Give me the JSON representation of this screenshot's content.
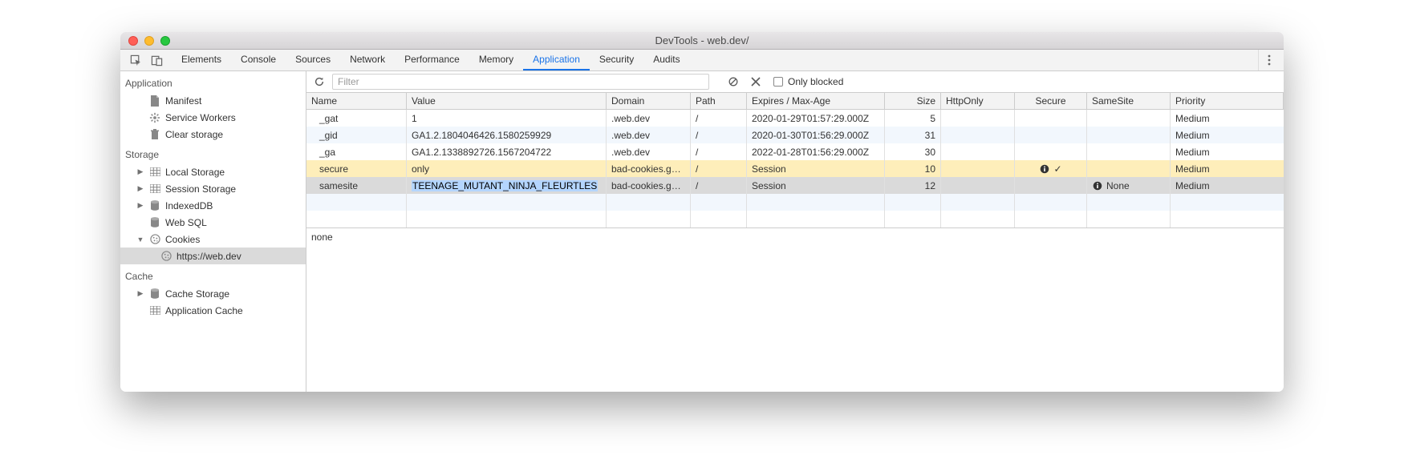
{
  "window": {
    "title": "DevTools - web.dev/"
  },
  "tabs": {
    "items": [
      "Elements",
      "Console",
      "Sources",
      "Network",
      "Performance",
      "Memory",
      "Application",
      "Security",
      "Audits"
    ],
    "active_index": 6
  },
  "sidebar": {
    "sections": {
      "application": {
        "label": "Application",
        "items": [
          {
            "label": "Manifest",
            "icon": "file"
          },
          {
            "label": "Service Workers",
            "icon": "gear"
          },
          {
            "label": "Clear storage",
            "icon": "trash"
          }
        ]
      },
      "storage": {
        "label": "Storage",
        "items": [
          {
            "label": "Local Storage",
            "icon": "grid",
            "expandable": true,
            "expanded": false
          },
          {
            "label": "Session Storage",
            "icon": "grid",
            "expandable": true,
            "expanded": false
          },
          {
            "label": "IndexedDB",
            "icon": "db",
            "expandable": true,
            "expanded": false
          },
          {
            "label": "Web SQL",
            "icon": "db",
            "expandable": false
          },
          {
            "label": "Cookies",
            "icon": "cookie",
            "expandable": true,
            "expanded": true,
            "children": [
              {
                "label": "https://web.dev",
                "icon": "cookie",
                "selected": true
              }
            ]
          }
        ]
      },
      "cache": {
        "label": "Cache",
        "items": [
          {
            "label": "Cache Storage",
            "icon": "db",
            "expandable": true,
            "expanded": false
          },
          {
            "label": "Application Cache",
            "icon": "grid",
            "expandable": false
          }
        ]
      }
    }
  },
  "toolbar": {
    "filter_placeholder": "Filter",
    "filter_value": "",
    "only_blocked_label": "Only blocked",
    "only_blocked_checked": false
  },
  "table": {
    "columns": [
      "Name",
      "Value",
      "Domain",
      "Path",
      "Expires / Max-Age",
      "Size",
      "HttpOnly",
      "Secure",
      "SameSite",
      "Priority"
    ],
    "rows": [
      {
        "name": "_gat",
        "value": "1",
        "domain": ".web.dev",
        "path": "/",
        "expires": "2020-01-29T01:57:29.000Z",
        "size": "5",
        "httpOnly": "",
        "secure": "",
        "secure_info": false,
        "sameSite": "",
        "sameSite_info": false,
        "priority": "Medium",
        "state": "even"
      },
      {
        "name": "_gid",
        "value": "GA1.2.1804046426.1580259929",
        "domain": ".web.dev",
        "path": "/",
        "expires": "2020-01-30T01:56:29.000Z",
        "size": "31",
        "httpOnly": "",
        "secure": "",
        "secure_info": false,
        "sameSite": "",
        "sameSite_info": false,
        "priority": "Medium",
        "state": "odd"
      },
      {
        "name": "_ga",
        "value": "GA1.2.1338892726.1567204722",
        "domain": ".web.dev",
        "path": "/",
        "expires": "2022-01-28T01:56:29.000Z",
        "size": "30",
        "httpOnly": "",
        "secure": "",
        "secure_info": false,
        "sameSite": "",
        "sameSite_info": false,
        "priority": "Medium",
        "state": "even"
      },
      {
        "name": "secure",
        "value": "only",
        "domain": "bad-cookies.g…",
        "path": "/",
        "expires": "Session",
        "size": "10",
        "httpOnly": "",
        "secure": "✓",
        "secure_info": true,
        "sameSite": "",
        "sameSite_info": false,
        "priority": "Medium",
        "state": "highlight"
      },
      {
        "name": "samesite",
        "value": "TEENAGE_MUTANT_NINJA_FLEURTLES",
        "value_highlight": true,
        "domain": "bad-cookies.g…",
        "path": "/",
        "expires": "Session",
        "size": "12",
        "httpOnly": "",
        "secure": "",
        "secure_info": false,
        "sameSite": "None",
        "sameSite_info": true,
        "priority": "Medium",
        "state": "selected"
      }
    ]
  },
  "bottom_pane": {
    "text": "none"
  }
}
